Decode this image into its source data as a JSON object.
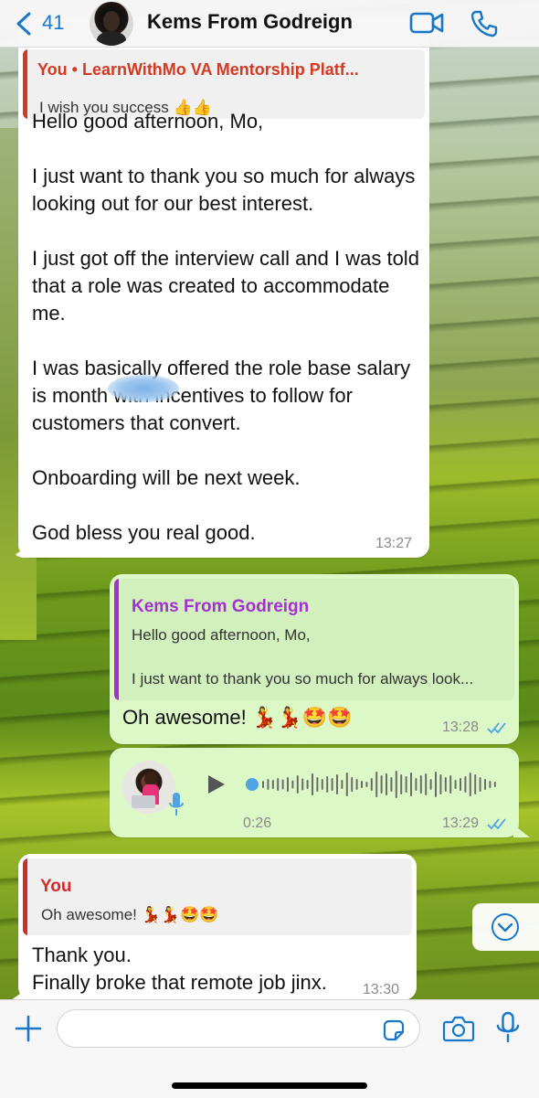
{
  "header": {
    "back_count": "41",
    "contact_name": "Kems From Godreign"
  },
  "messages": [
    {
      "direction": "incoming",
      "quoted_sender": "You • LearnWithMo VA Mentorship Platf...",
      "quoted_text": "I wish you success 👍👍",
      "text": "Hello good afternoon, Mo,\n\nI just want to thank you so much for always looking out for our best interest.\n\nI just got off the interview call and I was told that a role was created to accommodate me.\n\nI was basically offered the role base salary is          month with incentives to follow for customers that convert.\n\nOnboarding will be next week.\n\nGod bless you real good.",
      "time": "13:27"
    },
    {
      "direction": "outgoing",
      "quoted_sender": "Kems From Godreign",
      "quoted_text": "Hello good afternoon, Mo,\n\nI just want to thank you so much for always look...",
      "text": "Oh awesome! 💃💃🤩🤩",
      "time": "13:28",
      "status": "read"
    },
    {
      "direction": "outgoing",
      "type": "voice",
      "duration": "0:26",
      "time": "13:29",
      "status": "read"
    },
    {
      "direction": "incoming",
      "quoted_sender": "You",
      "quoted_text": "Oh awesome! 💃💃🤩🤩",
      "text": "Thank you.\nFinally broke that remote job jinx.",
      "time": "13:30"
    }
  ],
  "composer": {
    "placeholder": ""
  },
  "colors": {
    "accent": "#1877c9",
    "outgoing_bubble": "#dcf8c6",
    "incoming_bubble": "#ffffff",
    "quote_you": "#d13a23",
    "quote_contact": "#a52fd1",
    "read_ticks": "#4fa3e0"
  },
  "icons": [
    "back-chevron-icon",
    "video-call-icon",
    "phone-call-icon",
    "play-icon",
    "mic-icon",
    "scroll-down-icon",
    "plus-icon",
    "sticker-icon",
    "camera-icon",
    "double-check-icon"
  ]
}
